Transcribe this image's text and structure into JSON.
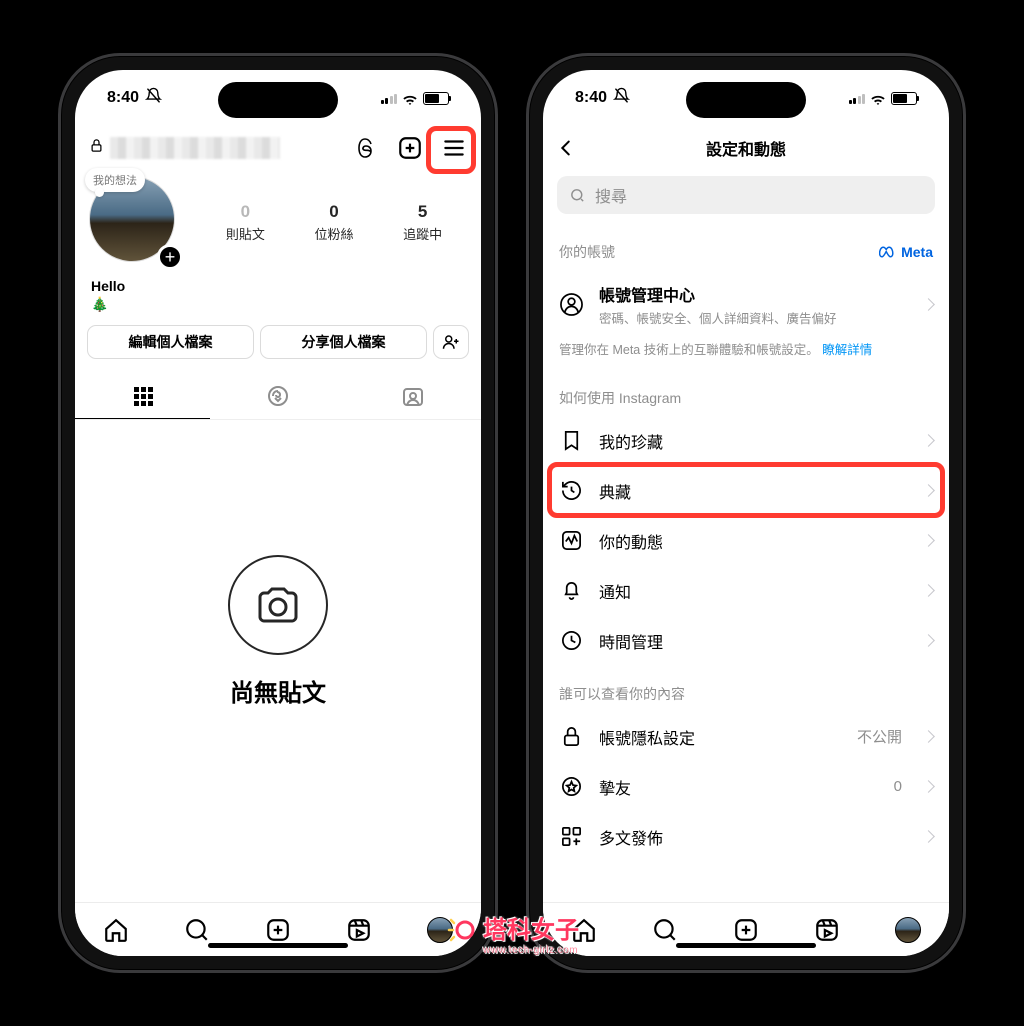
{
  "status": {
    "time": "8:40"
  },
  "profile": {
    "note_label": "我的想法",
    "stats": {
      "posts": {
        "value": "0",
        "label": "則貼文"
      },
      "followers": {
        "value": "0",
        "label": "位粉絲"
      },
      "following": {
        "value": "5",
        "label": "追蹤中"
      }
    },
    "display_name": "Hello",
    "bio": "🎄",
    "edit_btn": "編輯個人檔案",
    "share_btn": "分享個人檔案",
    "no_posts": "尚無貼文"
  },
  "settings": {
    "title": "設定和動態",
    "search_placeholder": "搜尋",
    "section_account": "你的帳號",
    "meta_label": "Meta",
    "account_center_title": "帳號管理中心",
    "account_center_sub": "密碼、帳號安全、個人詳細資料、廣告偏好",
    "account_center_desc_a": "管理你在 Meta 技術上的互聯體驗和帳號設定。",
    "account_center_desc_link": "瞭解詳情",
    "section_usage": "如何使用 Instagram",
    "row_saved": "我的珍藏",
    "row_archive": "典藏",
    "row_activity": "你的動態",
    "row_notifications": "通知",
    "row_time": "時間管理",
    "section_who": "誰可以查看你的內容",
    "row_privacy": "帳號隱私設定",
    "row_privacy_trail": "不公開",
    "row_close_friends": "摯友",
    "row_close_friends_trail": "0",
    "row_crosspost": "多文發佈"
  },
  "watermark": {
    "main": "塔科女子",
    "sub": "www.tech-girlz.com"
  }
}
